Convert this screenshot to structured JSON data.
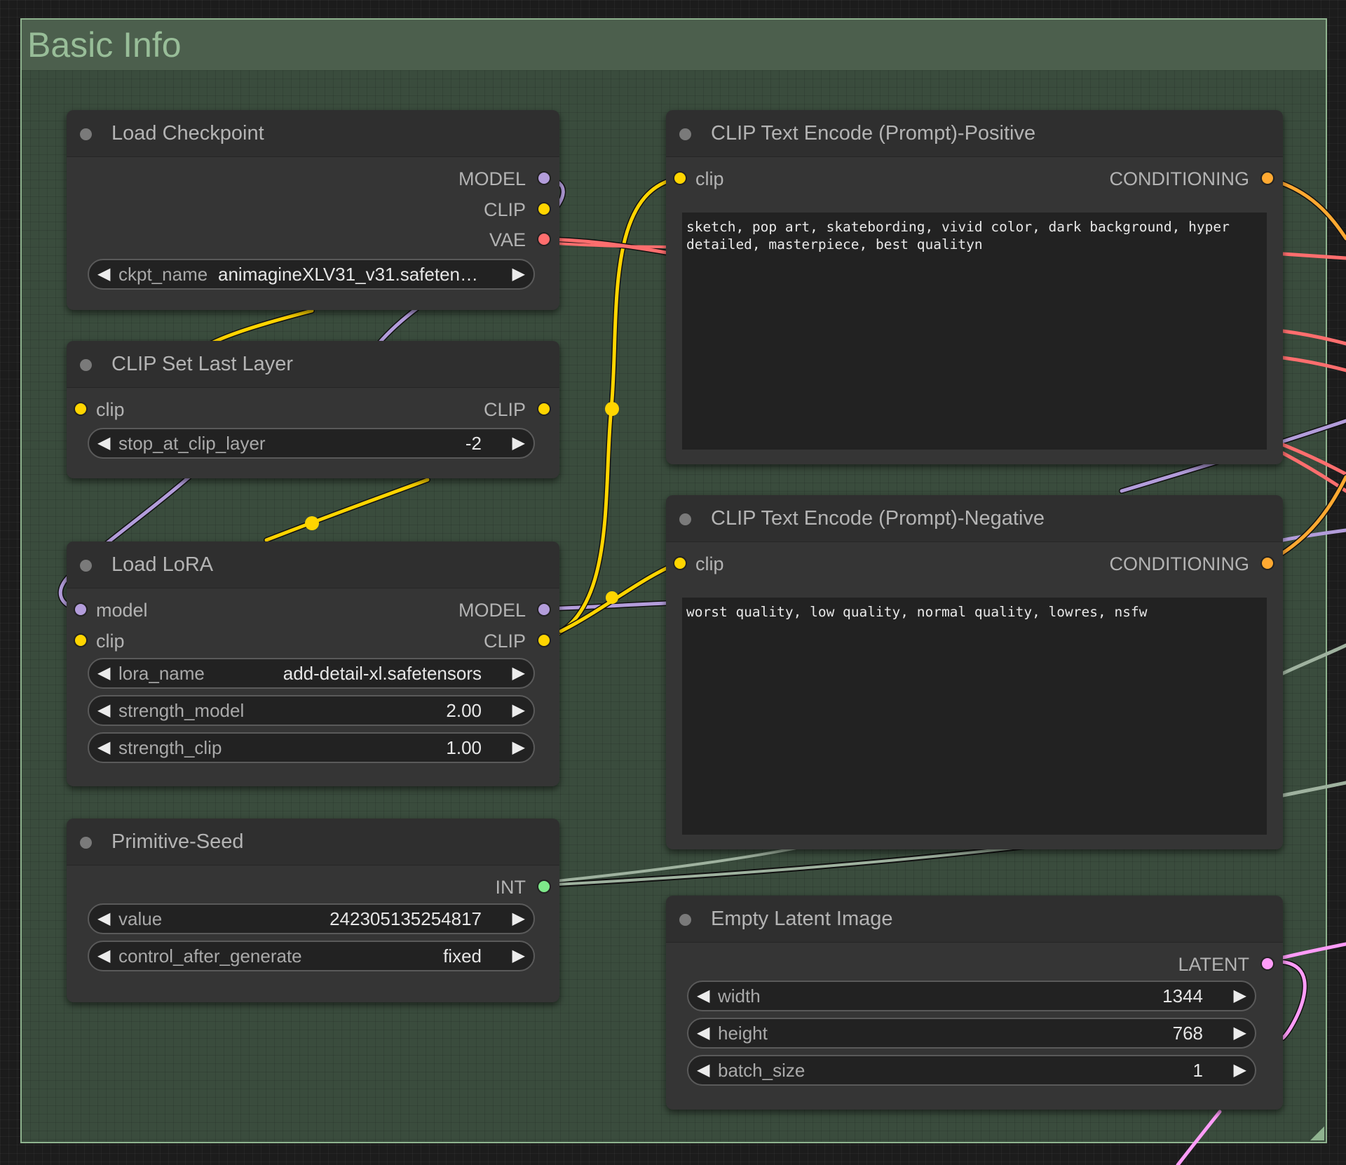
{
  "group": {
    "title": "Basic Info"
  },
  "colors": {
    "model": "#b39ddb",
    "clip": "#ffd500",
    "vae": "#ff6e6e",
    "conditioning": "#ffa931",
    "int": "#7ee88a",
    "latent": "#ff9cf9",
    "node_bg": "#353535",
    "group_border": "#8fb38f"
  },
  "nodes": {
    "load_checkpoint": {
      "title": "Load Checkpoint",
      "outputs": [
        "MODEL",
        "CLIP",
        "VAE"
      ],
      "widgets": [
        {
          "name": "ckpt_name",
          "value": "animagineXLV31_v31.safeten…"
        }
      ]
    },
    "clip_set_last_layer": {
      "title": "CLIP Set Last Layer",
      "inputs": [
        "clip"
      ],
      "outputs": [
        "CLIP"
      ],
      "widgets": [
        {
          "name": "stop_at_clip_layer",
          "value": "-2"
        }
      ]
    },
    "load_lora": {
      "title": "Load LoRA",
      "inputs": [
        "model",
        "clip"
      ],
      "outputs": [
        "MODEL",
        "CLIP"
      ],
      "widgets": [
        {
          "name": "lora_name",
          "value": "add-detail-xl.safetensors"
        },
        {
          "name": "strength_model",
          "value": "2.00"
        },
        {
          "name": "strength_clip",
          "value": "1.00"
        }
      ]
    },
    "primitive_seed": {
      "title": "Primitive-Seed",
      "outputs": [
        "INT"
      ],
      "widgets": [
        {
          "name": "value",
          "value": "242305135254817"
        },
        {
          "name": "control_after_generate",
          "value": "fixed"
        }
      ]
    },
    "clip_positive": {
      "title": "CLIP Text Encode (Prompt)-Positive",
      "inputs": [
        "clip"
      ],
      "outputs": [
        "CONDITIONING"
      ],
      "text": "sketch, pop art, skatebording, vivid color, dark background, hyper detailed, masterpiece, best qualityn"
    },
    "clip_negative": {
      "title": "CLIP Text Encode (Prompt)-Negative",
      "inputs": [
        "clip"
      ],
      "outputs": [
        "CONDITIONING"
      ],
      "text": "worst quality, low quality, normal quality, lowres, nsfw"
    },
    "empty_latent": {
      "title": "Empty Latent Image",
      "outputs": [
        "LATENT"
      ],
      "widgets": [
        {
          "name": "width",
          "value": "1344"
        },
        {
          "name": "height",
          "value": "768"
        },
        {
          "name": "batch_size",
          "value": "1"
        }
      ]
    }
  },
  "icons": {
    "arrow_left": "◀",
    "arrow_right": "▶"
  }
}
